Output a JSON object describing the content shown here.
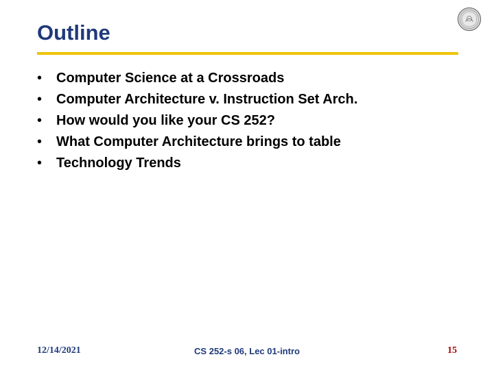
{
  "title": "Outline",
  "bullets": [
    "Computer Science at a Crossroads",
    "Computer Architecture v. Instruction Set Arch.",
    "How would you like your CS 252?",
    "What Computer Architecture brings to table",
    "Technology Trends"
  ],
  "footer": {
    "date": "12/14/2021",
    "center": "CS 252-s 06, Lec 01-intro",
    "page": "15"
  }
}
